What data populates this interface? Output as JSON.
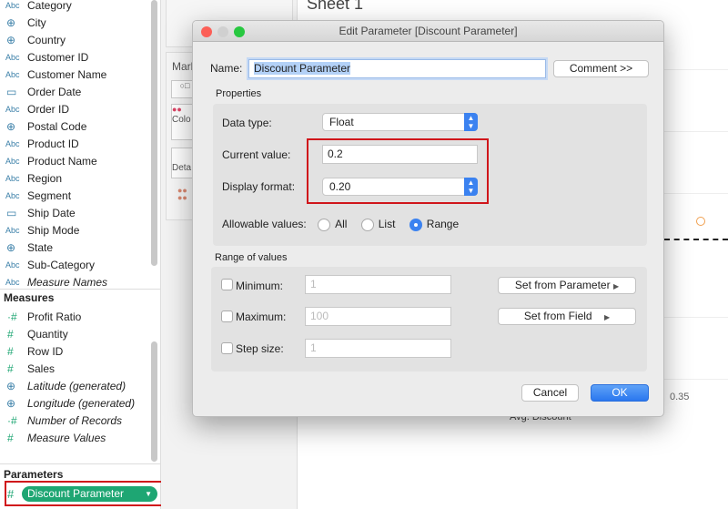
{
  "dimensions": [
    {
      "icon": "Abc",
      "label": "Category",
      "type": "string"
    },
    {
      "icon": "globe",
      "label": "City",
      "type": "geo"
    },
    {
      "icon": "globe",
      "label": "Country",
      "type": "geo"
    },
    {
      "icon": "Abc",
      "label": "Customer ID",
      "type": "string"
    },
    {
      "icon": "Abc",
      "label": "Customer Name",
      "type": "string"
    },
    {
      "icon": "calendar",
      "label": "Order Date",
      "type": "date"
    },
    {
      "icon": "Abc",
      "label": "Order ID",
      "type": "string"
    },
    {
      "icon": "globe",
      "label": "Postal Code",
      "type": "geo"
    },
    {
      "icon": "Abc",
      "label": "Product ID",
      "type": "string"
    },
    {
      "icon": "Abc",
      "label": "Product Name",
      "type": "string"
    },
    {
      "icon": "Abc",
      "label": "Region",
      "type": "string"
    },
    {
      "icon": "Abc",
      "label": "Segment",
      "type": "string"
    },
    {
      "icon": "calendar",
      "label": "Ship Date",
      "type": "date"
    },
    {
      "icon": "Abc",
      "label": "Ship Mode",
      "type": "string"
    },
    {
      "icon": "globe",
      "label": "State",
      "type": "geo"
    },
    {
      "icon": "Abc",
      "label": "Sub-Category",
      "type": "string"
    },
    {
      "icon": "Abc",
      "label": "Measure Names",
      "type": "string",
      "italic": true
    }
  ],
  "measures_header": "Measures",
  "measures": [
    {
      "icon": "calc-hash",
      "label": "Profit Ratio"
    },
    {
      "icon": "hash",
      "label": "Quantity"
    },
    {
      "icon": "hash",
      "label": "Row ID"
    },
    {
      "icon": "hash",
      "label": "Sales"
    },
    {
      "icon": "globe",
      "label": "Latitude (generated)",
      "italic": true
    },
    {
      "icon": "globe",
      "label": "Longitude (generated)",
      "italic": true
    },
    {
      "icon": "calc-hash",
      "label": "Number of Records",
      "italic": true
    },
    {
      "icon": "hash",
      "label": "Measure Values",
      "italic": true
    }
  ],
  "parameters_header": "Parameters",
  "parameter_pill": "Discount Parameter",
  "shelf": {
    "marks_label": "Mark",
    "color_label": "Colo",
    "detail_label": "Deta"
  },
  "sheet": {
    "title": "Sheet 1",
    "axis_tick": "0.35",
    "axis_title": "Avg. Discount"
  },
  "dialog": {
    "title": "Edit Parameter [Discount Parameter]",
    "name_label": "Name:",
    "name_value": "Discount Parameter",
    "comment_button": "Comment >>",
    "properties_label": "Properties",
    "data_type_label": "Data type:",
    "data_type_value": "Float",
    "current_value_label": "Current value:",
    "current_value": "0.2",
    "display_format_label": "Display format:",
    "display_format_value": "0.20",
    "allowable_label": "Allowable values:",
    "allowable_options": [
      "All",
      "List",
      "Range"
    ],
    "allowable_selected": "Range",
    "range_label": "Range of values",
    "minimum_label": "Minimum:",
    "minimum_placeholder": "1",
    "maximum_label": "Maximum:",
    "maximum_placeholder": "100",
    "step_label": "Step size:",
    "step_placeholder": "1",
    "set_from_parameter": "Set from Parameter",
    "set_from_field": "Set from Field",
    "cancel": "Cancel",
    "ok": "OK"
  },
  "colors": {
    "accent": "#3b82f0",
    "pill": "#1ea673",
    "highlight": "#d0161b",
    "mark": "#f0a050"
  }
}
